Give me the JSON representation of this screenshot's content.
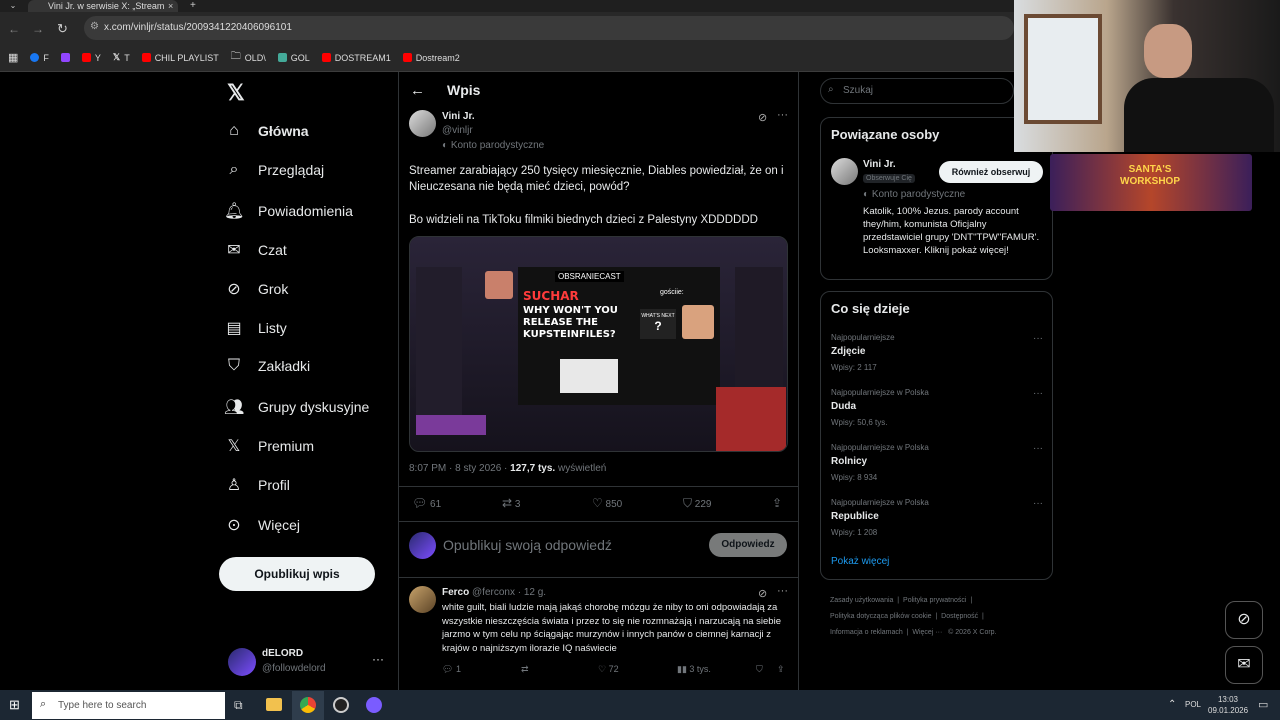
{
  "browser": {
    "tab_title": "Vini Jr. w serwisie X: „Stream",
    "url": "x.com/vinljr/status/2009341220406096101",
    "bookmarks": [
      {
        "label": "F"
      },
      {
        "label": "Y"
      },
      {
        "label": "T"
      },
      {
        "label": "CHIL PLAYLIST"
      },
      {
        "label": "OLD\\"
      },
      {
        "label": "GOL"
      },
      {
        "label": "DOSTREAM1"
      },
      {
        "label": "Dostream2"
      }
    ]
  },
  "nav": {
    "items": [
      {
        "label": "Główna",
        "icon": "home-icon"
      },
      {
        "label": "Przeglądaj",
        "icon": "search-icon"
      },
      {
        "label": "Powiadomienia",
        "icon": "bell-icon"
      },
      {
        "label": "Czat",
        "icon": "mail-icon"
      },
      {
        "label": "Grok",
        "icon": "grok-icon"
      },
      {
        "label": "Listy",
        "icon": "list-icon"
      },
      {
        "label": "Zakładki",
        "icon": "bookmark-icon"
      },
      {
        "label": "Grupy dyskusyjne",
        "icon": "people-icon"
      },
      {
        "label": "Premium",
        "icon": "x-icon"
      },
      {
        "label": "Profil",
        "icon": "person-icon"
      },
      {
        "label": "Więcej",
        "icon": "more-icon"
      }
    ],
    "post_button": "Opublikuj wpis",
    "me_name": "dELORD",
    "me_handle": "@followdelord"
  },
  "post": {
    "header": "Wpis",
    "author": "Vini Jr.",
    "handle": "@vinljr",
    "badge": "Konto parodystyczne",
    "text1": "Streamer zarabiający 250 tysięcy miesięcznie, Diables powiedział, że on i Nieuczesana nie będą mieć dzieci, powód?",
    "text2": "Bo widzieli na TikToku filmiki biednych dzieci z Palestyny XDDDDDD",
    "media": {
      "tag": "OBSRANIECAST",
      "title_top": "SUCHAR",
      "title_lines": [
        "WHY WON'T YOU",
        "RELEASE THE",
        "KUPSTEINFILES?"
      ],
      "right_label": "gościie:",
      "whats_next": "WHAT'S NEXT"
    },
    "time": "8:07 PM · 8 sty 2026 ·",
    "views": "127,7 tys.",
    "views_label": "wyświetleń",
    "replies": "61",
    "reposts": "3",
    "likes": "850",
    "bookmarks": "229",
    "reply_placeholder": "Opublikuj swoją odpowiedź",
    "reply_button": "Odpowiedz"
  },
  "reply": {
    "author": "Ferco",
    "handle": "@ferconx · 12 g.",
    "text": "white guilt, biali ludzie mają jakąś chorobę mózgu że niby to oni odpowiadają za wszystkie nieszczęścia świata i przez to się nie rozmnażają i narzucają na siebie jarzmo w tym celu np ściągając murzynów i innych panów o ciemnej karnacji z krajów o najniższym ilorazie IQ naświecie",
    "replies": "1",
    "likes": "72",
    "views": "3 tys."
  },
  "sidebar": {
    "search_placeholder": "Szukaj",
    "related_title": "Powiązane osoby",
    "related_name": "Vini Jr.",
    "follows_you": "Obserwuje Cię",
    "related_badge": "Konto parodystyczne",
    "follow_back": "Również obserwuj",
    "bio": "Katolik, 100% Jezus. parody account they/him, komunista Oficjalny przedstawiciel grupy 'DNT''TPW''FAMUR'. Looksmaxxer. Kliknij pokaż więcej!",
    "trends_title": "Co się dzieje",
    "trends": [
      {
        "cat": "Najpopularniejsze",
        "name": "Zdjęcie",
        "count": "Wpisy: 2 117"
      },
      {
        "cat": "Najpopularniejsze w Polska",
        "name": "Duda",
        "count": "Wpisy: 50,6 tys."
      },
      {
        "cat": "Najpopularniejsze w Polska",
        "name": "Rolnicy",
        "count": "Wpisy: 8 934"
      },
      {
        "cat": "Najpopularniejsze w Polska",
        "name": "Republice",
        "count": "Wpisy: 1 208"
      }
    ],
    "show_more": "Pokaż więcej",
    "footer": [
      "Zasady użytkowania",
      "Polityka prywatności",
      "Polityka dotycząca plików cookie",
      "Dostępność",
      "Informacja o reklamach",
      "Więcej ···",
      "© 2026 X Corp."
    ]
  },
  "overlay": {
    "banner": "SANTA'S WORKSHOP"
  },
  "taskbar": {
    "search_placeholder": "Type here to search",
    "lang": "POL",
    "time": "13:03",
    "date": "09.01.2026"
  },
  "colors": {
    "accent": "#1d9bf0",
    "bg": "#000000",
    "border": "#2f3336",
    "muted": "#71767b"
  }
}
